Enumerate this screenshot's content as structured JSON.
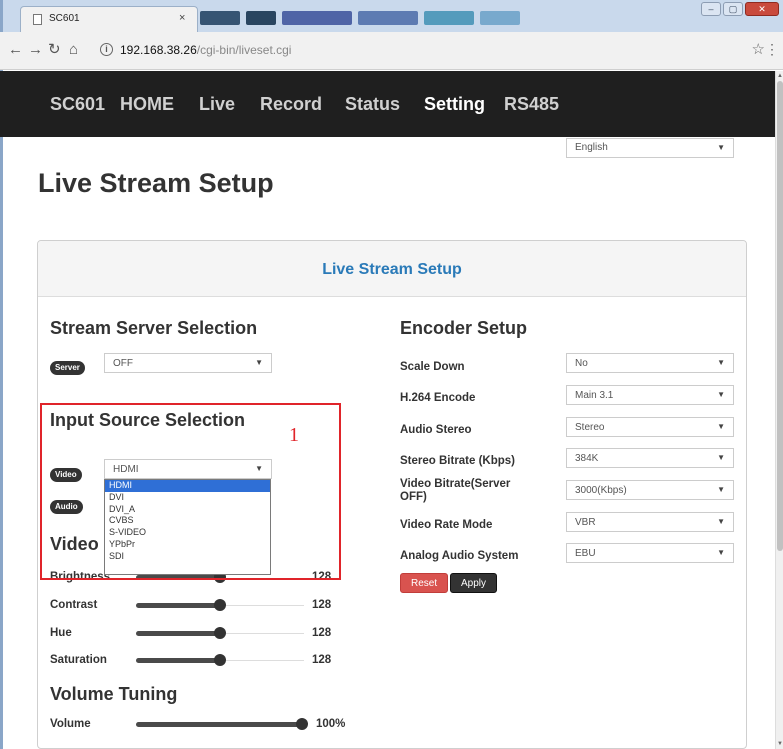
{
  "browser": {
    "tab_title": "SC601",
    "tab_close": "×",
    "url_host": "192.168.38.26",
    "url_path": "/cgi-bin/liveset.cgi",
    "win_minimize": "–",
    "win_maximize": "▢",
    "win_close": "✕"
  },
  "navbar": {
    "items": [
      {
        "label": "SC601"
      },
      {
        "label": "HOME"
      },
      {
        "label": "Live"
      },
      {
        "label": "Record"
      },
      {
        "label": "Status"
      },
      {
        "label": "Setting"
      },
      {
        "label": "RS485"
      }
    ],
    "active": "Setting"
  },
  "language": {
    "value": "English"
  },
  "page_title": "Live Stream Setup",
  "panel_title": "Live Stream Setup",
  "stream_server": {
    "title": "Stream Server Selection",
    "badge": "Server",
    "value": "OFF"
  },
  "input_source": {
    "title": "Input Source Selection",
    "video_badge": "Video",
    "audio_badge": "Audio",
    "value": "HDMI",
    "options": [
      "HDMI",
      "DVI",
      "DVI_A",
      "CVBS",
      "S-VIDEO",
      "YPbPr",
      "SDI"
    ],
    "annotation": "1"
  },
  "video_section": {
    "title": "Video",
    "sliders": [
      {
        "label": "Brightness",
        "value": "128"
      },
      {
        "label": "Contrast",
        "value": "128"
      },
      {
        "label": "Hue",
        "value": "128"
      },
      {
        "label": "Saturation",
        "value": "128"
      }
    ]
  },
  "volume_section": {
    "title": "Volume Tuning",
    "label": "Volume",
    "value": "100%"
  },
  "encoder": {
    "title": "Encoder Setup",
    "rows": [
      {
        "label": "Scale Down",
        "value": "No"
      },
      {
        "label": "H.264 Encode",
        "value": "Main 3.1"
      },
      {
        "label": "Audio Stereo",
        "value": "Stereo"
      },
      {
        "label": "Stereo Bitrate (Kbps)",
        "value": "384K"
      },
      {
        "label": "Video Bitrate(Server OFF)",
        "value": "3000(Kbps)"
      },
      {
        "label": "Video Rate Mode",
        "value": "VBR"
      },
      {
        "label": "Analog Audio System",
        "value": "EBU"
      }
    ],
    "reset_label": "Reset",
    "apply_label": "Apply"
  },
  "colors": {
    "navbar_bg": "#1f1f1f",
    "panel_title": "#2a7ab8",
    "reset": "#d9534f",
    "highlight": "#e0242a",
    "dropdown_selected": "#2f6fd6"
  }
}
